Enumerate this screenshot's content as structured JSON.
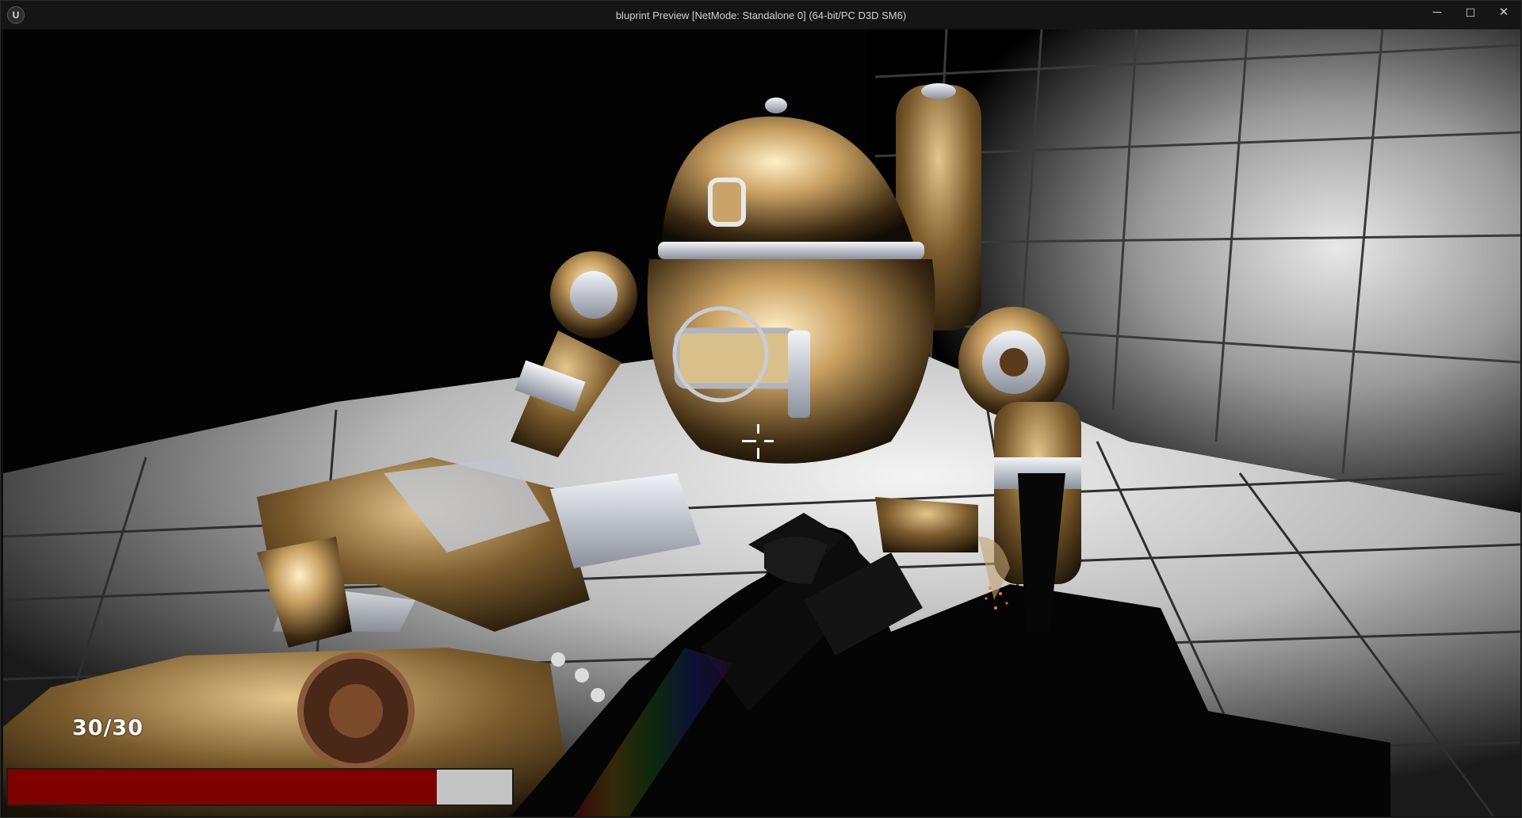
{
  "window": {
    "title": "bluprint Preview [NetMode: Standalone 0]  (64-bit/PC D3D SM6)",
    "logo_icon": "unreal-engine-logo",
    "controls": {
      "minimize": "─",
      "maximize": "☐",
      "close": "✕"
    }
  },
  "hud": {
    "ammo": "30/30",
    "health_fraction": 0.85,
    "health_color": "#7e0000",
    "health_background": "#c4c4c4",
    "crosshair_icon": "crosshair-icon"
  },
  "scene": {
    "description_icons": [
      "robot",
      "rifle",
      "tiled-room"
    ]
  }
}
